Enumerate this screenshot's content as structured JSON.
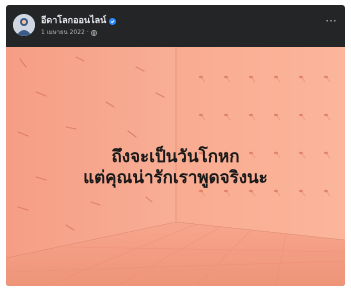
{
  "post": {
    "page_name": "อีดาโลกออนไลน์",
    "date": "1 เมษายน 2022",
    "separator": "·",
    "more_label": "···",
    "verified_icon": "verified-badge-icon",
    "privacy_icon": "globe-icon",
    "image": {
      "caption_line_1": "ถึงจะเป็นวันโกหก",
      "caption_line_2": "แต่คุณน่ารักเราพูดจริงนะ"
    }
  },
  "colors": {
    "card_background": "#242526",
    "room_wall": "#f7a58c",
    "room_floor": "#f09a82",
    "verified": "#2d88ff"
  }
}
